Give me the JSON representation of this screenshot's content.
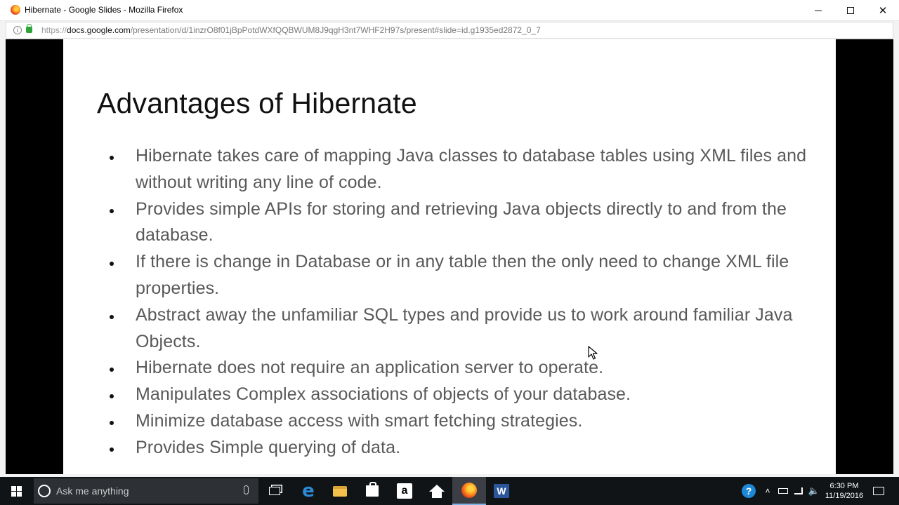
{
  "window": {
    "title": "Hibernate - Google Slides - Mozilla Firefox"
  },
  "address_bar": {
    "scheme": "https://",
    "domain": "docs.google.com",
    "path": "/presentation/d/1inzrO8f01jBpPotdWXfQQBWUM8J9qgH3nt7WHF2H97s/present#slide=id.g1935ed2872_0_7"
  },
  "slide": {
    "title": "Advantages of Hibernate",
    "bullets": [
      "Hibernate takes care of mapping Java classes to database tables using XML files and without writing any line of code.",
      "Provides simple APIs for storing and retrieving Java objects directly to and from the database.",
      "If there is change in Database or in any table then the only need to change XML file properties.",
      "Abstract away the unfamiliar SQL types and provide us to work around familiar Java Objects.",
      "Hibernate does not require an application server to operate.",
      "Manipulates Complex associations of objects of your database.",
      "Minimize database access with smart fetching strategies.",
      "Provides Simple querying of data."
    ]
  },
  "taskbar": {
    "search_placeholder": "Ask me anything",
    "amazon_letter": "a",
    "word_letter": "W",
    "help_glyph": "?",
    "clock_time": "6:30 PM",
    "clock_date": "11/19/2016"
  },
  "colors": {
    "slide_text": "#595959",
    "slide_title": "#111111",
    "presentation_background": "#000000",
    "taskbar": "#111417"
  }
}
